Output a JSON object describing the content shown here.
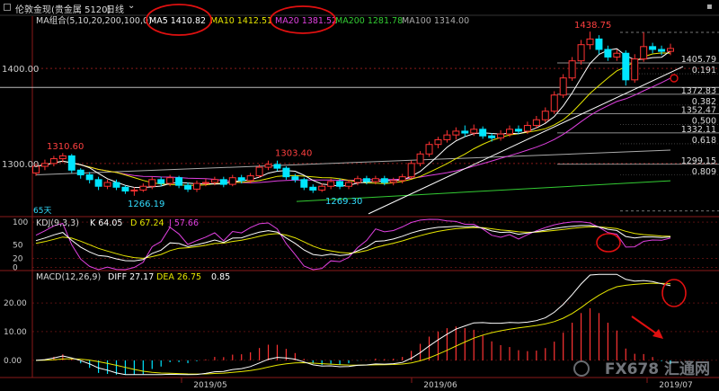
{
  "header": {
    "title": "伦敦金现(贵金属 5120)",
    "period": "日线",
    "dropdown_icon": "chevron-down-icon"
  },
  "ma_legend": [
    {
      "label": "MA组合(5,10,20,200,100,0)",
      "color": "#d8d8d8"
    },
    {
      "label": "MA5 1410.82",
      "color": "#ffffff"
    },
    {
      "label": "MA10 1412.51",
      "color": "#e6e600"
    },
    {
      "label": "MA20 1381.52",
      "color": "#e040e0"
    },
    {
      "label": "MA200 1281.78",
      "color": "#33cc33"
    },
    {
      "label": "MA100 1314.00",
      "color": "#aaaaaa"
    }
  ],
  "kdj_legend": [
    {
      "label": "KDJ(9,3,3)",
      "color": "#d8d8d8"
    },
    {
      "label": "K 64.05",
      "color": "#ffffff"
    },
    {
      "label": "D 67.24",
      "color": "#e6e600"
    },
    {
      "label": "J 57.66",
      "color": "#e040e0"
    }
  ],
  "macd_legend": [
    {
      "label": "MACD(12,26,9)",
      "color": "#d8d8d8"
    },
    {
      "label": "DIFF 27.17",
      "color": "#ffffff"
    },
    {
      "label": "DEA 26.75",
      "color": "#e6e600"
    },
    {
      "label": "0.85",
      "color": "#ffffff"
    }
  ],
  "colors": {
    "up": "#ff3333",
    "down": "#00e5ff",
    "ma5": "#ffffff",
    "ma10": "#e6e600",
    "ma20": "#e040e0",
    "ma200": "#33cc33",
    "ma100": "#aaaaaa",
    "axis": "#8a1a1a",
    "annotation": "#e01010"
  },
  "watermark": "FX678 汇通网",
  "chart_data": {
    "type": "candlestick",
    "price_ticks": [
      "1400.00",
      "1300.00"
    ],
    "price_ticks_values": [
      1400,
      1300
    ],
    "price_range": [
      1245,
      1455
    ],
    "x_labels": [
      "2019/05",
      "2019/06",
      "2019/07"
    ],
    "annotations": {
      "high_label": "1438.75",
      "left_high": "1310.60",
      "mid_high": "1303.40",
      "low1": "1266.19",
      "low2": "1269.30",
      "days_label": "65天"
    },
    "fib_levels": [
      {
        "price": "1405.79",
        "ratio": "0.191",
        "value": 1405.79
      },
      {
        "price": "1372.83",
        "ratio": "0.382",
        "value": 1372.83
      },
      {
        "price": "1352.47",
        "ratio": "0.500",
        "value": 1352.47
      },
      {
        "price": "1332.11",
        "ratio": "0.618",
        "value": 1332.11
      },
      {
        "price": "1299.15",
        "ratio": "0.809",
        "value": 1299.15
      }
    ],
    "candles": [
      {
        "o": 1290,
        "c": 1297,
        "h": 1300,
        "l": 1287
      },
      {
        "o": 1297,
        "c": 1300,
        "h": 1304,
        "l": 1293
      },
      {
        "o": 1300,
        "c": 1305,
        "h": 1308,
        "l": 1297
      },
      {
        "o": 1305,
        "c": 1308,
        "h": 1311,
        "l": 1301
      },
      {
        "o": 1308,
        "c": 1293,
        "h": 1310,
        "l": 1290
      },
      {
        "o": 1293,
        "c": 1288,
        "h": 1295,
        "l": 1284
      },
      {
        "o": 1288,
        "c": 1283,
        "h": 1291,
        "l": 1279
      },
      {
        "o": 1283,
        "c": 1276,
        "h": 1286,
        "l": 1272
      },
      {
        "o": 1276,
        "c": 1280,
        "h": 1283,
        "l": 1273
      },
      {
        "o": 1280,
        "c": 1275,
        "h": 1283,
        "l": 1272
      },
      {
        "o": 1275,
        "c": 1271,
        "h": 1277,
        "l": 1268
      },
      {
        "o": 1271,
        "c": 1272,
        "h": 1275,
        "l": 1266
      },
      {
        "o": 1272,
        "c": 1276,
        "h": 1279,
        "l": 1270
      },
      {
        "o": 1276,
        "c": 1283,
        "h": 1286,
        "l": 1273
      },
      {
        "o": 1283,
        "c": 1279,
        "h": 1286,
        "l": 1276
      },
      {
        "o": 1279,
        "c": 1285,
        "h": 1288,
        "l": 1276
      },
      {
        "o": 1285,
        "c": 1277,
        "h": 1287,
        "l": 1274
      },
      {
        "o": 1277,
        "c": 1273,
        "h": 1280,
        "l": 1270
      },
      {
        "o": 1273,
        "c": 1279,
        "h": 1282,
        "l": 1270
      },
      {
        "o": 1279,
        "c": 1280,
        "h": 1284,
        "l": 1276
      },
      {
        "o": 1280,
        "c": 1283,
        "h": 1286,
        "l": 1277
      },
      {
        "o": 1283,
        "c": 1278,
        "h": 1286,
        "l": 1275
      },
      {
        "o": 1278,
        "c": 1285,
        "h": 1288,
        "l": 1276
      },
      {
        "o": 1285,
        "c": 1282,
        "h": 1288,
        "l": 1279
      },
      {
        "o": 1282,
        "c": 1287,
        "h": 1290,
        "l": 1279
      },
      {
        "o": 1287,
        "c": 1296,
        "h": 1299,
        "l": 1285
      },
      {
        "o": 1296,
        "c": 1299,
        "h": 1303,
        "l": 1293
      },
      {
        "o": 1299,
        "c": 1295,
        "h": 1303,
        "l": 1292
      },
      {
        "o": 1295,
        "c": 1286,
        "h": 1297,
        "l": 1283
      },
      {
        "o": 1286,
        "c": 1283,
        "h": 1289,
        "l": 1280
      },
      {
        "o": 1283,
        "c": 1275,
        "h": 1285,
        "l": 1272
      },
      {
        "o": 1275,
        "c": 1272,
        "h": 1278,
        "l": 1269
      },
      {
        "o": 1272,
        "c": 1276,
        "h": 1279,
        "l": 1270
      },
      {
        "o": 1276,
        "c": 1281,
        "h": 1284,
        "l": 1273
      },
      {
        "o": 1281,
        "c": 1276,
        "h": 1284,
        "l": 1273
      },
      {
        "o": 1276,
        "c": 1280,
        "h": 1283,
        "l": 1273
      },
      {
        "o": 1280,
        "c": 1284,
        "h": 1287,
        "l": 1277
      },
      {
        "o": 1284,
        "c": 1281,
        "h": 1287,
        "l": 1278
      },
      {
        "o": 1281,
        "c": 1284,
        "h": 1287,
        "l": 1278
      },
      {
        "o": 1284,
        "c": 1280,
        "h": 1287,
        "l": 1277
      },
      {
        "o": 1280,
        "c": 1282,
        "h": 1285,
        "l": 1277
      },
      {
        "o": 1282,
        "c": 1286,
        "h": 1289,
        "l": 1279
      },
      {
        "o": 1286,
        "c": 1300,
        "h": 1303,
        "l": 1284
      },
      {
        "o": 1300,
        "c": 1310,
        "h": 1313,
        "l": 1297
      },
      {
        "o": 1310,
        "c": 1320,
        "h": 1323,
        "l": 1307
      },
      {
        "o": 1320,
        "c": 1325,
        "h": 1328,
        "l": 1316
      },
      {
        "o": 1325,
        "c": 1330,
        "h": 1335,
        "l": 1322
      },
      {
        "o": 1330,
        "c": 1334,
        "h": 1338,
        "l": 1325
      },
      {
        "o": 1334,
        "c": 1332,
        "h": 1340,
        "l": 1328
      },
      {
        "o": 1332,
        "c": 1336,
        "h": 1341,
        "l": 1329
      },
      {
        "o": 1336,
        "c": 1329,
        "h": 1339,
        "l": 1326
      },
      {
        "o": 1329,
        "c": 1327,
        "h": 1332,
        "l": 1323
      },
      {
        "o": 1327,
        "c": 1331,
        "h": 1335,
        "l": 1324
      },
      {
        "o": 1331,
        "c": 1336,
        "h": 1340,
        "l": 1328
      },
      {
        "o": 1336,
        "c": 1334,
        "h": 1340,
        "l": 1331
      },
      {
        "o": 1334,
        "c": 1340,
        "h": 1344,
        "l": 1331
      },
      {
        "o": 1340,
        "c": 1346,
        "h": 1350,
        "l": 1337
      },
      {
        "o": 1346,
        "c": 1355,
        "h": 1359,
        "l": 1343
      },
      {
        "o": 1355,
        "c": 1372,
        "h": 1376,
        "l": 1352
      },
      {
        "o": 1372,
        "c": 1390,
        "h": 1394,
        "l": 1369
      },
      {
        "o": 1390,
        "c": 1408,
        "h": 1412,
        "l": 1387
      },
      {
        "o": 1408,
        "c": 1425,
        "h": 1430,
        "l": 1404
      },
      {
        "o": 1425,
        "c": 1431,
        "h": 1438.75,
        "l": 1420
      },
      {
        "o": 1431,
        "c": 1420,
        "h": 1435,
        "l": 1415
      },
      {
        "o": 1420,
        "c": 1412,
        "h": 1424,
        "l": 1408
      },
      {
        "o": 1412,
        "c": 1416,
        "h": 1420,
        "l": 1408
      },
      {
        "o": 1416,
        "c": 1388,
        "h": 1419,
        "l": 1382
      },
      {
        "o": 1388,
        "c": 1410,
        "h": 1415,
        "l": 1385
      },
      {
        "o": 1410,
        "c": 1423,
        "h": 1438,
        "l": 1407
      },
      {
        "o": 1423,
        "c": 1420,
        "h": 1427,
        "l": 1416
      },
      {
        "o": 1420,
        "c": 1418,
        "h": 1424,
        "l": 1414
      },
      {
        "o": 1418,
        "c": 1421,
        "h": 1426,
        "l": 1414
      }
    ],
    "ma200_line": {
      "from": 1260,
      "to": 1281.78
    },
    "ma100_line": {
      "from": 1288,
      "to": 1314.0
    },
    "kdj": {
      "ticks": [
        "100",
        "50",
        "20",
        "0"
      ],
      "ticks_values": [
        100,
        50,
        20,
        0
      ],
      "range": [
        -5,
        110
      ]
    },
    "macd": {
      "ticks": [
        "20.00",
        "10.00",
        "0.00"
      ],
      "ticks_values": [
        20,
        10,
        0
      ],
      "range": [
        -6,
        31
      ]
    }
  }
}
